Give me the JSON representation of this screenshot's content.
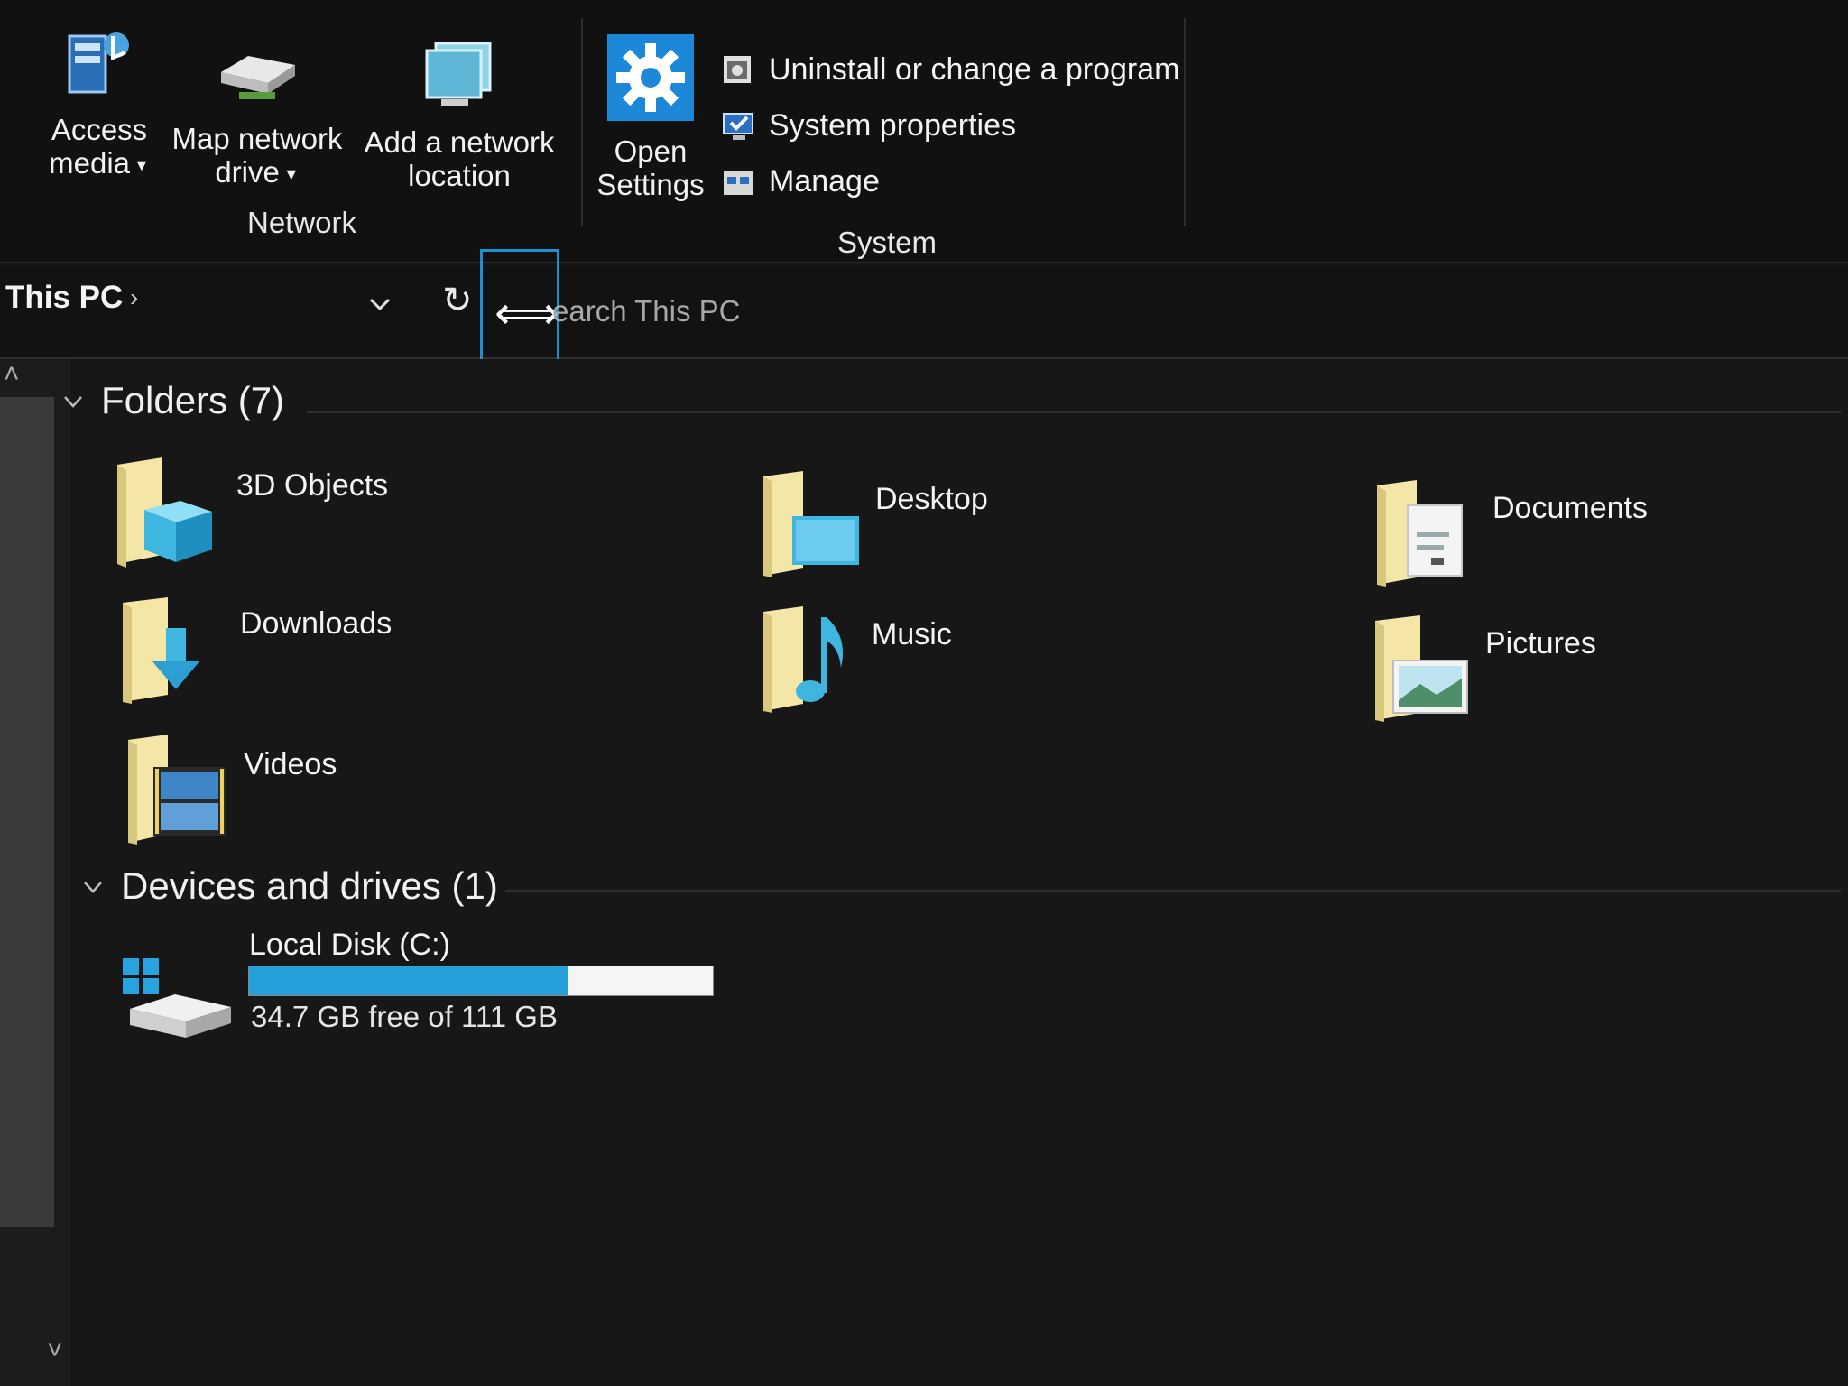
{
  "ribbon": {
    "network_group": {
      "label": "Network",
      "buttons": [
        {
          "label_line1": "Access",
          "label_line2": "media",
          "has_dropdown": true,
          "icon": "media-server-icon"
        },
        {
          "label_line1": "Map network",
          "label_line2": "drive",
          "has_dropdown": true,
          "icon": "network-drive-icon"
        },
        {
          "label_line1": "Add a network",
          "label_line2": "location",
          "has_dropdown": false,
          "icon": "network-location-icon"
        }
      ]
    },
    "system_group": {
      "label": "System",
      "open_settings": {
        "label_line1": "Open",
        "label_line2": "Settings",
        "icon": "gear-icon"
      },
      "items": [
        {
          "label": "Uninstall or change a program",
          "icon": "uninstall-icon"
        },
        {
          "label": "System properties",
          "icon": "system-properties-icon"
        },
        {
          "label": "Manage",
          "icon": "manage-icon"
        }
      ]
    }
  },
  "address_bar": {
    "breadcrumb": "This PC",
    "search_placeholder": "Search This PC",
    "search_visible_text": "earch This PC"
  },
  "sections": {
    "folders": {
      "title": "Folders (7)",
      "items": [
        {
          "name": "3D Objects",
          "icon": "3d-objects-folder-icon"
        },
        {
          "name": "Desktop",
          "icon": "desktop-folder-icon"
        },
        {
          "name": "Documents",
          "icon": "documents-folder-icon"
        },
        {
          "name": "Downloads",
          "icon": "downloads-folder-icon"
        },
        {
          "name": "Music",
          "icon": "music-folder-icon"
        },
        {
          "name": "Pictures",
          "icon": "pictures-folder-icon"
        },
        {
          "name": "Videos",
          "icon": "videos-folder-icon"
        }
      ]
    },
    "devices": {
      "title": "Devices and drives (1)",
      "drives": [
        {
          "name": "Local Disk (C:)",
          "free_text": "34.7 GB free of 111 GB",
          "used_fraction": 0.687,
          "icon": "windows-drive-icon"
        }
      ]
    }
  },
  "colors": {
    "accent": "#26a0da",
    "folder": "#f3e6a6",
    "background": "#171717",
    "selection_border": "#1b8fd0"
  }
}
